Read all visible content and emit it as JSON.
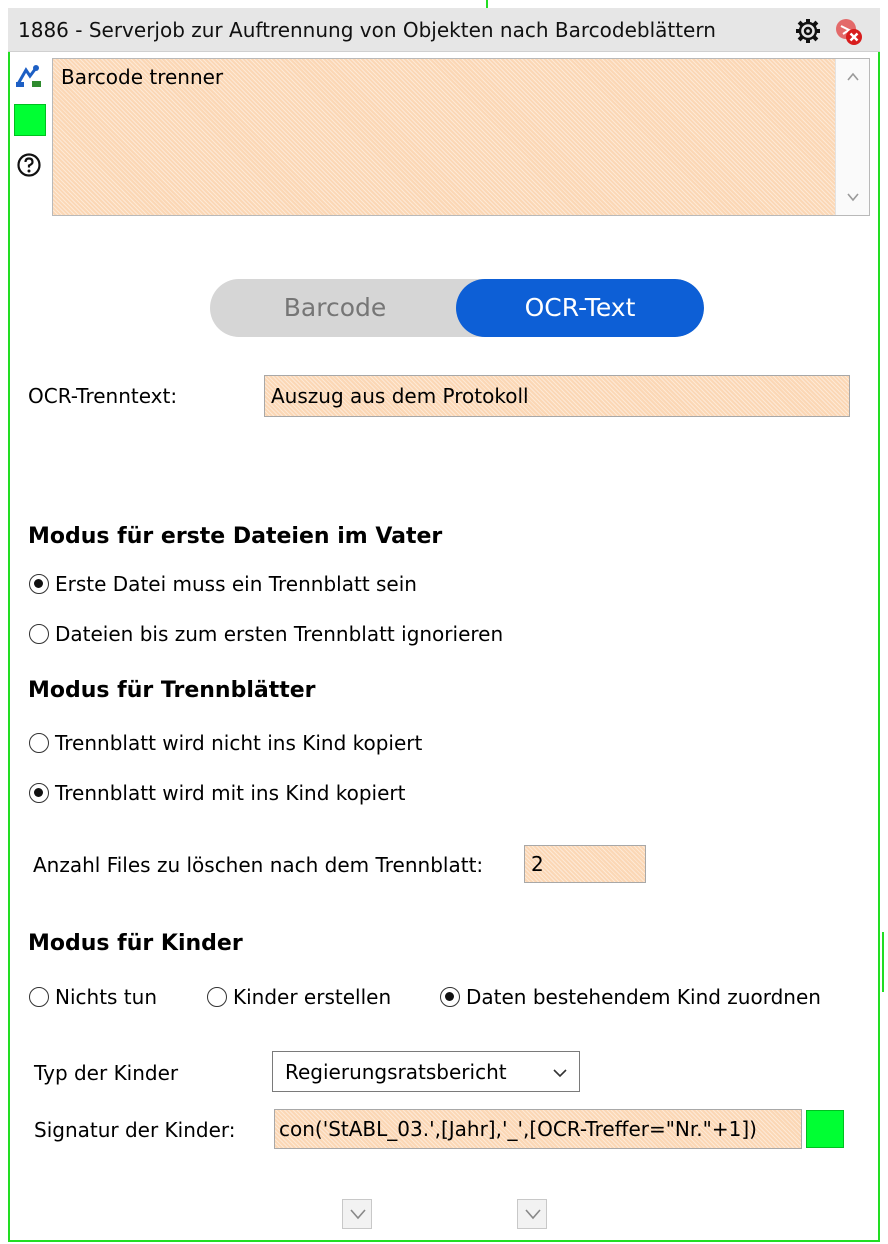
{
  "window": {
    "title": "1886 - Serverjob zur Auftrennung von Objekten nach Barcodeblättern",
    "settings_icon": "gear-icon",
    "close_icon": "close-red-icon"
  },
  "sidebar_icons": [
    "connection-icon",
    "status-color-swatch",
    "help-icon"
  ],
  "description": {
    "value": "Barcode trenner"
  },
  "mode_toggle": {
    "options": [
      "Barcode",
      "OCR-Text"
    ],
    "selected": "OCR-Text"
  },
  "ocr": {
    "label": "OCR-Trenntext:",
    "value": "Auszug aus dem Protokoll"
  },
  "first_files": {
    "heading": "Modus für erste Dateien im Vater",
    "options": [
      {
        "label": "Erste Datei muss ein Trennblatt sein",
        "checked": true
      },
      {
        "label": "Dateien bis zum ersten Trennblatt ignorieren",
        "checked": false
      }
    ]
  },
  "separator": {
    "heading": "Modus für Trennblätter",
    "options": [
      {
        "label": "Trennblatt wird nicht ins Kind kopiert",
        "checked": false
      },
      {
        "label": "Trennblatt wird mit ins Kind kopiert",
        "checked": true
      }
    ]
  },
  "delete_count": {
    "label": "Anzahl Files zu löschen nach dem Trennblatt:",
    "value": "2"
  },
  "children": {
    "heading": "Modus für Kinder",
    "options": [
      {
        "label": "Nichts tun",
        "checked": false
      },
      {
        "label": "Kinder erstellen",
        "checked": false
      },
      {
        "label": "Daten bestehendem Kind zuordnen",
        "checked": true
      }
    ]
  },
  "child_type": {
    "label": "Typ der Kinder",
    "selected": "Regierungsratsbericht"
  },
  "child_signature": {
    "label": "Signatur der Kinder:",
    "value": "con('StABL_03.',[Jahr],'_',[OCR-Treffer=\"Nr.\"+1])"
  },
  "colors": {
    "frame_border": "#22dd22",
    "field_bg": "#fbd7b5",
    "toggle_active": "#0d5fd6",
    "toggle_inactive": "#d6d6d6",
    "swatch": "#00ff33"
  }
}
